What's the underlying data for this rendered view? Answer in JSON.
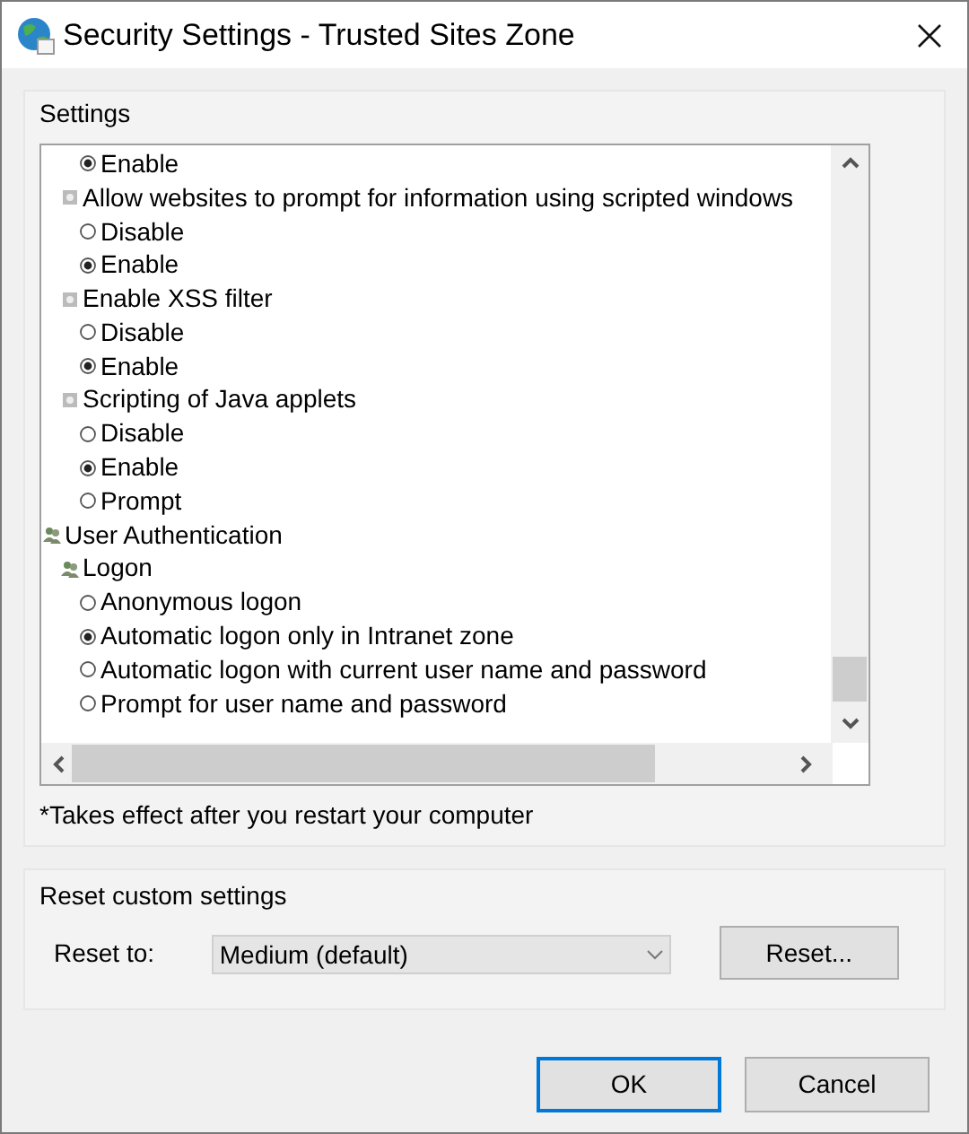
{
  "window": {
    "title": "Security Settings - Trusted Sites Zone"
  },
  "settings": {
    "label": "Settings",
    "items": [
      {
        "kind": "option",
        "label": "Enable",
        "selected": true
      },
      {
        "kind": "setting",
        "label": "Allow websites to prompt for information using scripted windows",
        "children": [
          {
            "kind": "option",
            "label": "Disable",
            "selected": false
          },
          {
            "kind": "option",
            "label": "Enable",
            "selected": true
          }
        ]
      },
      {
        "kind": "setting",
        "label": "Enable XSS filter",
        "children": [
          {
            "kind": "option",
            "label": "Disable",
            "selected": false
          },
          {
            "kind": "option",
            "label": "Enable",
            "selected": true
          }
        ]
      },
      {
        "kind": "setting",
        "label": "Scripting of Java applets",
        "children": [
          {
            "kind": "option",
            "label": "Disable",
            "selected": false
          },
          {
            "kind": "option",
            "label": "Enable",
            "selected": true
          },
          {
            "kind": "option",
            "label": "Prompt",
            "selected": false
          }
        ]
      },
      {
        "kind": "group",
        "label": "User Authentication",
        "children": [
          {
            "kind": "group",
            "label": "Logon",
            "children": [
              {
                "kind": "option",
                "label": "Anonymous logon",
                "selected": false
              },
              {
                "kind": "option",
                "label": "Automatic logon only in Intranet zone",
                "selected": true
              },
              {
                "kind": "option",
                "label": "Automatic logon with current user name and password",
                "selected": false
              },
              {
                "kind": "option",
                "label": "Prompt for user name and password",
                "selected": false
              }
            ]
          }
        ]
      }
    ],
    "note": "*Takes effect after you restart your computer"
  },
  "reset": {
    "label": "Reset custom settings",
    "field_label": "Reset to:",
    "value": "Medium (default)",
    "button": "Reset..."
  },
  "buttons": [
    "OK",
    "Cancel"
  ]
}
